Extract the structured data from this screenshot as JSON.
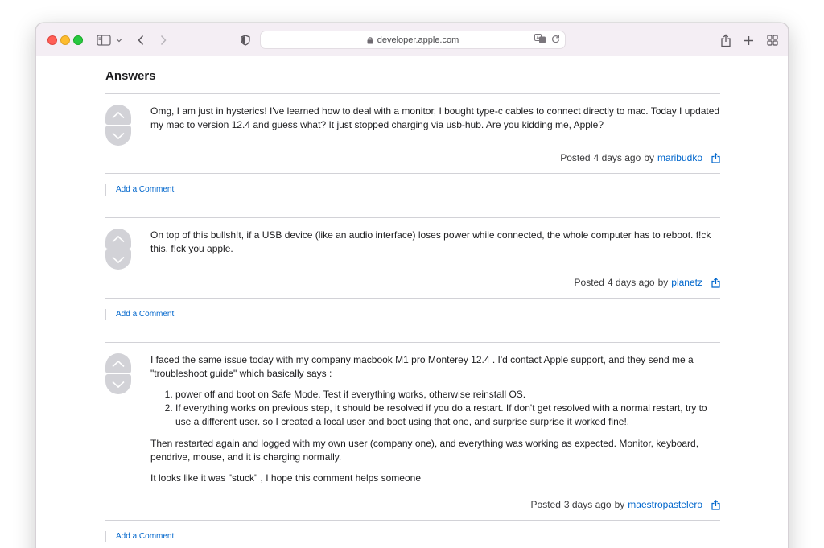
{
  "browser": {
    "url": "developer.apple.com",
    "accent": "#0066cc"
  },
  "page": {
    "heading": "Answers",
    "add_comment_label": "Add a Comment",
    "posted_prefix": "Posted",
    "by_word": "by"
  },
  "answers": [
    {
      "paragraphs": [
        "Omg, I am just in hysterics! I've learned how to deal with a monitor, I bought type-c cables to connect directly to mac. Today I updated my mac to version 12.4 and guess what? It just stopped charging via usb-hub. Are you kidding me, Apple?"
      ],
      "time": "4 days ago",
      "user": "maribudko"
    },
    {
      "paragraphs": [
        "On top of this bullsh!t, if a USB device (like an audio interface) loses power while connected, the whole computer has to reboot. f!ck this, f!ck you apple."
      ],
      "time": "4 days ago",
      "user": "planetz"
    },
    {
      "intro": "I faced the same issue today with my company macbook M1 pro Monterey 12.4 . I'd contact Apple support, and they send me a \"troubleshoot guide\" which basically says :",
      "list": [
        "power off and boot on Safe Mode. Test if everything works, otherwise reinstall OS.",
        "If everything works on previous step, it should be resolved if you do a restart. If don't get resolved with a normal restart, try to use a different user. so I created a local user and boot using that one, and surprise surprise it worked fine!."
      ],
      "paragraphs": [
        "Then restarted again and logged with my own user (company one), and everything was working as expected. Monitor, keyboard, pendrive, mouse, and it is charging normally.",
        "It looks like it was \"stuck\" , I hope this comment helps someone"
      ],
      "time": "3 days ago",
      "user": "maestropastelero"
    }
  ],
  "icons": {
    "share": "share-icon",
    "upvote": "chevron-up-icon",
    "downvote": "chevron-down-icon",
    "lock": "lock-icon",
    "translate": "translate-icon",
    "reload": "reload-icon"
  }
}
